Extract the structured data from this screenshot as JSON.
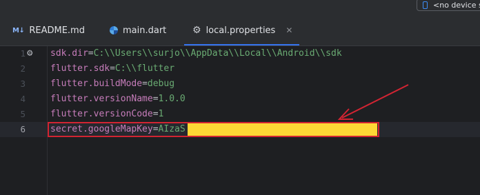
{
  "toolbar": {
    "device_label": "<no device s"
  },
  "tabs": [
    {
      "label": "README.md",
      "icon": "markdown-icon",
      "icon_text": "M↓"
    },
    {
      "label": "main.dart",
      "icon": "dart-icon"
    },
    {
      "label": "local.properties",
      "icon": "gear-icon",
      "active": true
    }
  ],
  "editor": {
    "lines": [
      {
        "num": "1",
        "key": "sdk.dir",
        "value": "C:\\\\Users\\\\surjo\\\\AppData\\\\Local\\\\Android\\\\sdk"
      },
      {
        "num": "2",
        "key": "flutter.sdk",
        "value": "C:\\\\flutter"
      },
      {
        "num": "3",
        "key": "flutter.buildMode",
        "value": "debug"
      },
      {
        "num": "4",
        "key": "flutter.versionName",
        "value": "1.0.0"
      },
      {
        "num": "5",
        "key": "flutter.versionCode",
        "value": "1"
      },
      {
        "num": "6",
        "key": "secret.googleMapKey",
        "value": "AIzaS"
      }
    ],
    "current_line": "6"
  },
  "colors": {
    "keyword": "#c77dbb",
    "string": "#6aab73",
    "annotation_red": "#d32432",
    "redaction_yellow": "#fdd835",
    "tab_underline": "#3574f0"
  }
}
